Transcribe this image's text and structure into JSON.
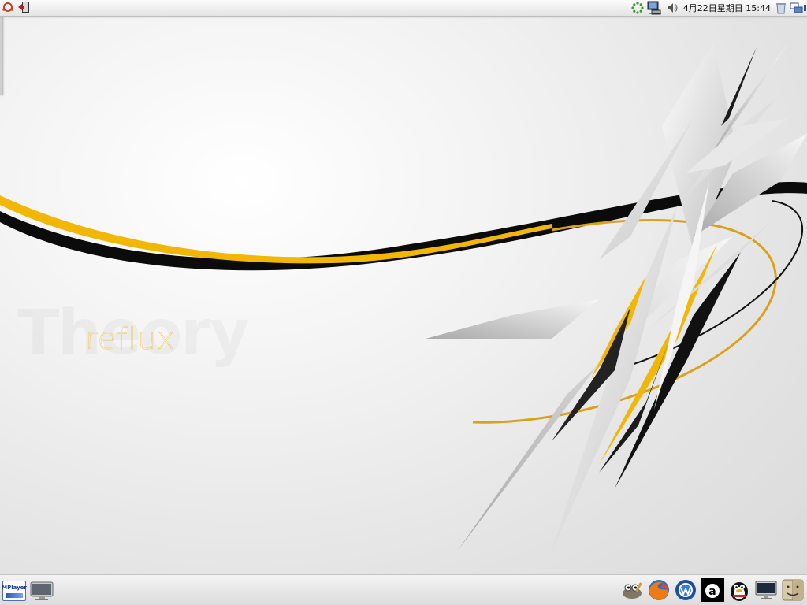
{
  "top_panel": {
    "clock": "4月22日星期日  15:44",
    "left_icons": [
      "ubuntu-menu-icon",
      "logout-icon"
    ],
    "tray_icons": [
      "update-notifier-icon",
      "network-monitor-icon",
      "volume-icon",
      "clock",
      "trash-icon",
      "workspace-switcher-icon"
    ]
  },
  "wallpaper": {
    "brand_text": "reflux",
    "accent_color": "#f0b200",
    "stroke_color": "#000000"
  },
  "bottom_panel": {
    "mplayer_label": "MPlayer",
    "dock_icons": [
      "gimp-icon",
      "firefox-icon",
      "thunderbird-icon",
      "amarok-icon",
      "qq-penguin-icon",
      "computer-icon",
      "finder-icon"
    ]
  }
}
